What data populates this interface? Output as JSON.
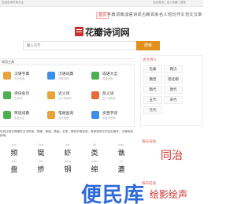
{
  "topbar": {
    "left": "在线查询字典大全",
    "right": "设为首页 | 加入收藏 | 登录"
  },
  "nav": [
    "首页",
    "字典",
    "词典",
    "成语",
    "诗词",
    "古籍",
    "百家",
    "名人",
    "短句",
    "作文",
    "范文",
    "文章"
  ],
  "logo": {
    "text": "花瓣诗词网"
  },
  "search": {
    "placeholder": "输入汉字",
    "button": "搜索"
  },
  "tools": {
    "header": "常用工具",
    "items": [
      {
        "name": "汉语字典",
        "sub": "汉字查询",
        "color": "#e8a33b"
      },
      {
        "name": "汉语词典",
        "sub": "词语查询",
        "color": "#3b8fe8"
      },
      {
        "name": "成语大全",
        "sub": "成语查询",
        "color": "#4caf50"
      },
      {
        "name": "诗词名句",
        "sub": "古诗词",
        "color": "#4caf50"
      },
      {
        "name": "近义词",
        "sub": "近义词查询",
        "color": "#e8a33b"
      },
      {
        "name": "反义词",
        "sub": "反义词查询",
        "color": "#e86a3b"
      },
      {
        "name": "笑话词典",
        "sub": "笑话大全",
        "color": "#4caf50"
      },
      {
        "name": "笔顺查询",
        "sub": "汉字笔顺",
        "color": "#e8a33b"
      },
      {
        "name": "多音字词",
        "sub": "多音字查询",
        "color": "#3b8fe8"
      }
    ]
  },
  "dynasty": {
    "header": "古今诗人",
    "items": [
      "先秦",
      "两汉",
      "魏晋",
      "南北朝",
      "隋代",
      "唐代",
      "五代",
      "宋代",
      "元代"
    ]
  },
  "intro": "在线汉语字典提供汉字拼音、笔顺、部首、笔画、五笔、繁体字等查询，收录常用汉字及生僻字，方便查询使用。",
  "chars": [
    {
      "py": "pín",
      "ch": "频"
    },
    {
      "py": "tǐng",
      "ch": "铤"
    },
    {
      "py": "xiā",
      "ch": "虾"
    },
    {
      "py": "lèi",
      "ch": "类"
    },
    {
      "py": "qiáo",
      "ch": "谯"
    },
    {
      "py": "pán",
      "ch": "盘"
    },
    {
      "py": "jiǎo",
      "ch": "挢"
    },
    {
      "py": "gāng",
      "ch": "钢"
    },
    {
      "py": "mián",
      "ch": "绵"
    },
    {
      "py": "lù",
      "ch": "漉"
    }
  ],
  "daily_word": {
    "header": "每日词语",
    "word": "同治"
  },
  "daily_idiom": {
    "header": "每日成语",
    "word": "绘影绘声"
  },
  "watermark": "便民库"
}
